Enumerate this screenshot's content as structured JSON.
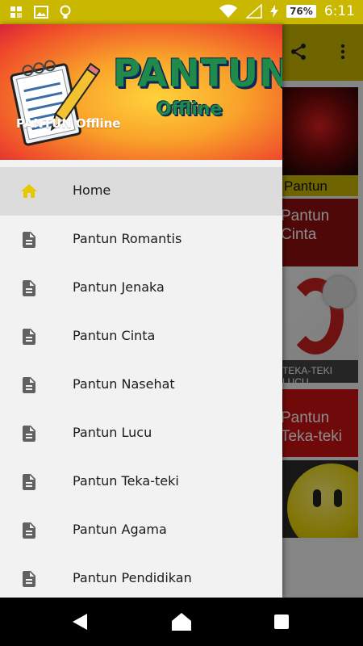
{
  "status_bar": {
    "battery": "76%",
    "time": "6:11",
    "icons_left": [
      "gallery-grid-icon",
      "image-icon",
      "bulb-icon"
    ],
    "icons_right": [
      "wifi-icon",
      "signal-icon",
      "charging-icon",
      "battery-icon"
    ]
  },
  "app_toolbar": {
    "actions": [
      "share-icon",
      "more-vert-icon"
    ]
  },
  "background_tiles": {
    "tile1_caption": "Pantun Cinta",
    "tile2_label": "Pantun Cinta",
    "tile3_caption": "TEKA-TEKI LUCU",
    "tile4_label": "Pantun Teka-teki"
  },
  "drawer": {
    "brand_title": "PANTUN",
    "brand_subtitle": "Offline",
    "header_subtitle": "PANTUN Offline",
    "items": [
      {
        "label": "Home",
        "icon": "home-icon"
      },
      {
        "label": "Pantun Romantis",
        "icon": "document-icon"
      },
      {
        "label": "Pantun Jenaka",
        "icon": "document-icon"
      },
      {
        "label": "Pantun Cinta",
        "icon": "document-icon"
      },
      {
        "label": "Pantun Nasehat",
        "icon": "document-icon"
      },
      {
        "label": "Pantun Lucu",
        "icon": "document-icon"
      },
      {
        "label": "Pantun Teka-teki",
        "icon": "document-icon"
      },
      {
        "label": "Pantun Agama",
        "icon": "document-icon"
      },
      {
        "label": "Pantun Pendidikan",
        "icon": "document-icon"
      }
    ]
  },
  "nav_bar": {
    "buttons": [
      "back-icon",
      "home-icon",
      "recents-icon"
    ]
  },
  "colors": {
    "accent": "#c9b700",
    "home_icon": "#e8c800",
    "doc_icon": "#616161",
    "active_row": "#dcdcdc"
  }
}
